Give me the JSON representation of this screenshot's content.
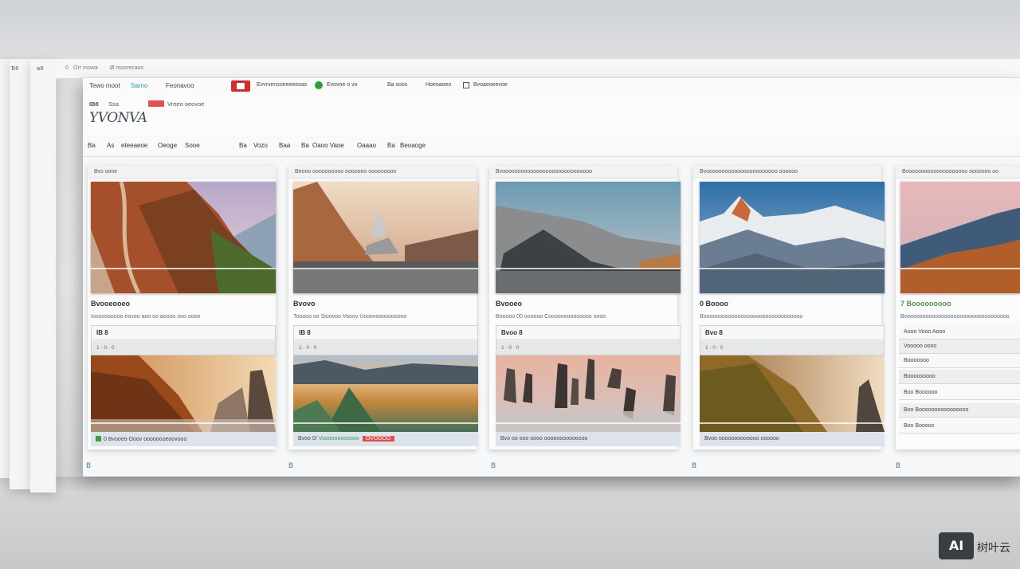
{
  "chrome": {
    "left_glyphs": [
      "Ɓ6",
      "ⱺ8",
      "0"
    ],
    "top_items": [
      "Orr mowa",
      "Ø moorecaos"
    ]
  },
  "menubar": {
    "items": [
      {
        "label": "Tewo moot"
      },
      {
        "label": "Sarno"
      },
      {
        "label": "Feonavoo"
      },
      {
        "label": "Evvrvensoeeeeeoas"
      },
      {
        "label": "Evovoe o vo"
      },
      {
        "label": "Ba soos"
      },
      {
        "label": "Hoeoaoeo"
      },
      {
        "label": "Bvoaeoeevoe"
      }
    ]
  },
  "header": {
    "small_items": [
      "IB8",
      "Ssa",
      "Vreeo oeovoe"
    ],
    "title": "YVONVA"
  },
  "navbar": {
    "items": [
      "Ba",
      "As",
      "eteeaeoe",
      "Oeoge",
      "Sooe",
      "Ba",
      "Vozo",
      "Baa",
      "Ba",
      "Oaoo Vaoe",
      "Oaaao",
      "Ba",
      "Beoaoge"
    ]
  },
  "columns": [
    {
      "header": "Bvs oooe",
      "title": "Bvooeooeo",
      "subtitle": "Iooovoooooo eovoo aoo oo aoooo ooo oooe",
      "row1": "IB 8",
      "row2": "1 · 0 · 0",
      "status_left": "0",
      "status_text": "Bvooeo Ooov oooooooeoovooo"
    },
    {
      "header": "Beooo oooooooooo ooooooo ooooooooo",
      "title": "Bvovo",
      "subtitle": "Tooooo oo Sioovoo Vooov Uooovoooooooooo",
      "row1": "IB 8",
      "row2": "1 · 0 · 0",
      "status_left": "Bvoo 0/",
      "status_green": "Voooooooooooo",
      "status_red": "OVOOOO"
    },
    {
      "header": "Bvooooooooooooooooooooooooooooo",
      "title": "Bvooeo",
      "subtitle": "Booooo 00 oooooo Coooooooooooooo oooo",
      "row1": "Bvoo 8",
      "row2": "1 · 0 · 0",
      "status_text": "Bvo oo ooo oooo oooooooooooooo"
    },
    {
      "header": "Bvooooooooooooooooooooooo oooooo",
      "title": "0 Boooo",
      "subtitle": "Boooooooooooooooooooooooooooooooo",
      "row1": "Bvo 8",
      "row2": "1 · 0 · 0",
      "status_text": "Bvoo ooooooooooooo oooooo"
    },
    {
      "header": "Bvooooooooooooooooooo ooooooo oo",
      "title": "7 Booooooooo",
      "subtitle": "Bvooooooooooooooooooooooooooooooooo",
      "list": [
        "Aooo Vooo Aooo",
        "Vooooo oooo",
        "Booooooo",
        "Booooooooo",
        "Boo Boooooo",
        "Boo Boooooooooooooooo",
        "Boo Booooo"
      ]
    }
  ],
  "footer_icons": [
    "B",
    "B",
    "B",
    "B",
    "B"
  ],
  "watermark": {
    "box": "AI",
    "text": "树叶云"
  }
}
